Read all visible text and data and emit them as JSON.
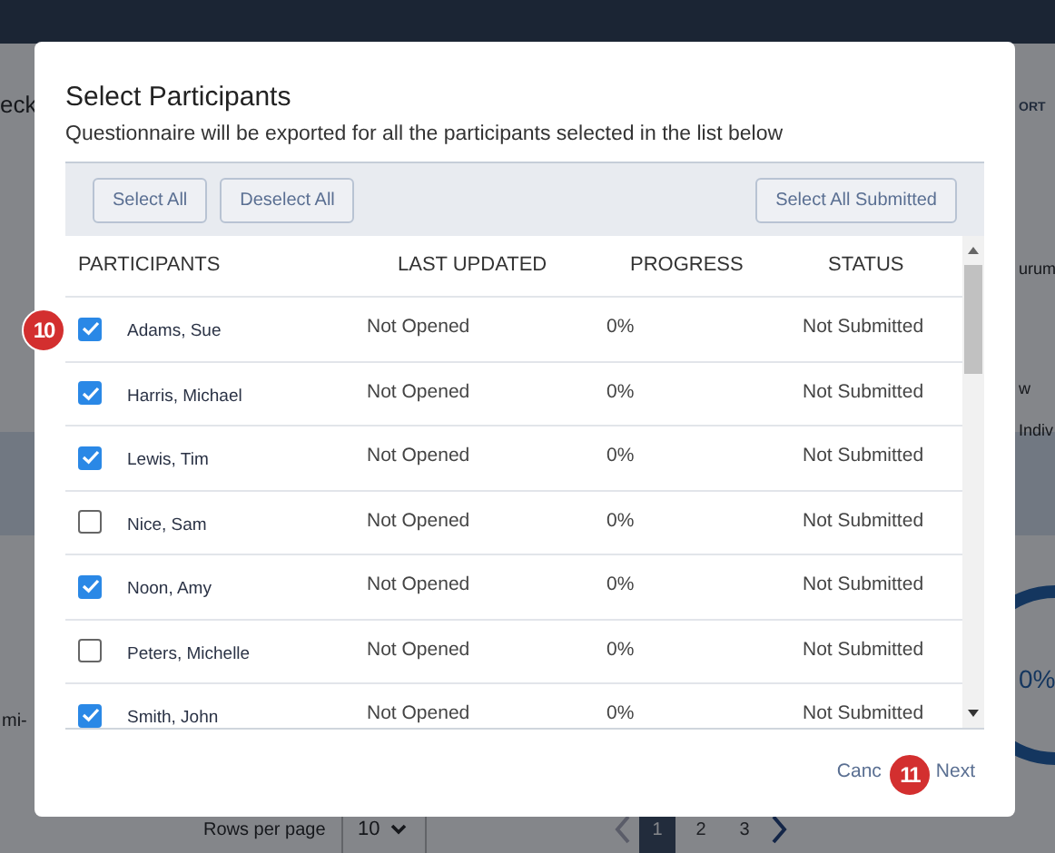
{
  "background": {
    "page_title": "eck",
    "export_link": "ORT",
    "side_texts": [
      "urum",
      "w",
      "Indiv"
    ],
    "row_text": "mi-",
    "progress_reading": "0%",
    "rows_per_page_label": "Rows per page",
    "rows_per_page_value": "10",
    "pages": [
      {
        "label": "1",
        "selected": true
      },
      {
        "label": "2",
        "selected": false
      },
      {
        "label": "3",
        "selected": false
      }
    ]
  },
  "dialog": {
    "title": "Select Participants",
    "subtitle": "Questionnaire will be exported for all the participants selected in the list below",
    "toolbar_buttons": [
      "Select All",
      "Deselect All"
    ],
    "toolbar_right_button": "Select All Submitted",
    "table": {
      "columns": [
        "PARTICIPANTS",
        "LAST UPDATED",
        "PROGRESS",
        "STATUS"
      ],
      "rows": [
        {
          "name": "Adams, Sue",
          "last_updated": "Not Opened",
          "progress": "0%",
          "status": "Not Submitted",
          "checked": true
        },
        {
          "name": "Harris, Michael",
          "last_updated": "Not Opened",
          "progress": "0%",
          "status": "Not Submitted",
          "checked": true
        },
        {
          "name": "Lewis, Tim",
          "last_updated": "Not Opened",
          "progress": "0%",
          "status": "Not Submitted",
          "checked": true
        },
        {
          "name": "Nice, Sam",
          "last_updated": "Not Opened",
          "progress": "0%",
          "status": "Not Submitted",
          "checked": false
        },
        {
          "name": "Noon, Amy",
          "last_updated": "Not Opened",
          "progress": "0%",
          "status": "Not Submitted",
          "checked": true
        },
        {
          "name": "Peters, Michelle",
          "last_updated": "Not Opened",
          "progress": "0%",
          "status": "Not Submitted",
          "checked": false
        },
        {
          "name": "Smith, John",
          "last_updated": "Not Opened",
          "progress": "0%",
          "status": "Not Submitted",
          "checked": true
        }
      ]
    },
    "footer_buttons": [
      "Canc",
      "Next"
    ]
  },
  "callouts": [
    "10",
    "11"
  ]
}
